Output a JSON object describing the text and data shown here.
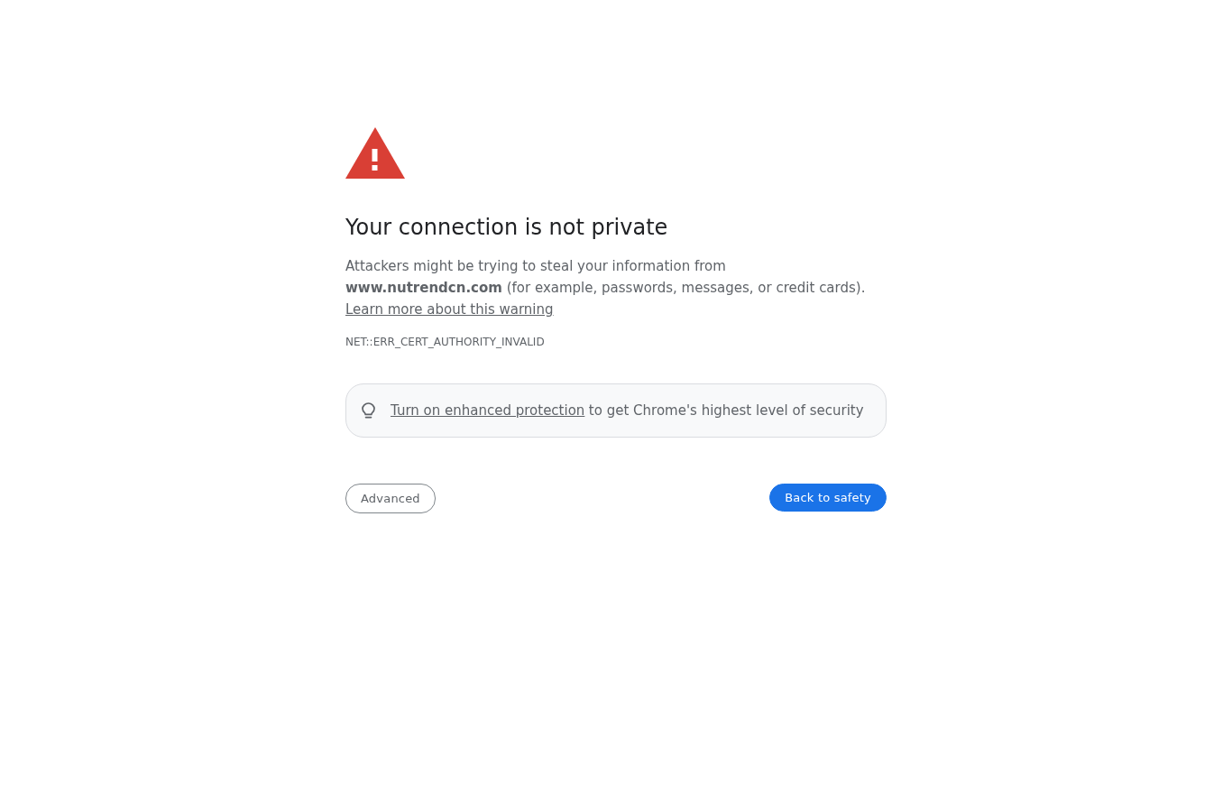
{
  "heading": "Your connection is not private",
  "message": "Attackers might be trying to steal your information from **www.nutrendcn.com** (for example, passwords, messages, or credit cards).",
  "learn_more_link": "Learn more about this warning",
  "error_code": "NET::ERR_CERT_AUTHORITY_INVALID",
  "protection_banner": {
    "link": "Turn on enhanced protection",
    "text": "to get Chrome's highest level of security"
  },
  "buttons": [
    {
      "label": "Advanced",
      "kind": "secondary"
    },
    {
      "label": "Back to safety",
      "kind": "primary"
    }
  ]
}
